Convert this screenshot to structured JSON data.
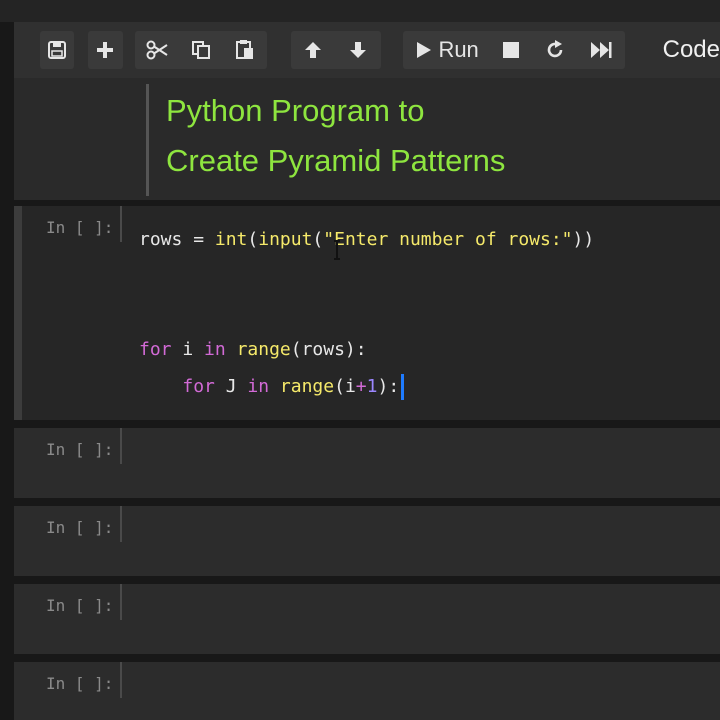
{
  "toolbar": {
    "run_label": "Run",
    "cell_type": "Code",
    "icons": [
      "save-icon",
      "add-icon",
      "cut-icon",
      "copy-icon",
      "paste-icon",
      "arrow-up-icon",
      "arrow-down-icon",
      "play-icon",
      "stop-icon",
      "restart-icon",
      "fast-forward-icon"
    ]
  },
  "markdown": {
    "line1": "Python Program to",
    "line2": "Create Pyramid Patterns"
  },
  "cells": [
    {
      "prompt": "In [ ]:",
      "lines": {
        "l1_var": "rows",
        "l1_eq": " = ",
        "l1_fn1": "int",
        "l1_p1": "(",
        "l1_fn2": "input",
        "l1_p2": "(",
        "l1_str": "\"Enter number of rows:\"",
        "l1_p3": "))",
        "l2_for": "for",
        "l2_i": " i ",
        "l2_in": "in",
        "l2_sp": " ",
        "l2_range": "range",
        "l2_rest": "(rows):",
        "l3_indent": "    ",
        "l3_for": "for",
        "l3_j": " J ",
        "l3_in": "in",
        "l3_sp": " ",
        "l3_range": "range",
        "l3_a": "(i",
        "l3_plus": "+",
        "l3_one": "1",
        "l3_b": "):"
      }
    },
    {
      "prompt": "In [ ]:"
    },
    {
      "prompt": "In [ ]:"
    },
    {
      "prompt": "In [ ]:"
    },
    {
      "prompt": "In [ ]:"
    }
  ],
  "colors": {
    "heading": "#8ee53f",
    "keyword": "#d26ad6",
    "builtin": "#f5e96a",
    "number": "#9b86ff",
    "cursor": "#1e7bff"
  }
}
